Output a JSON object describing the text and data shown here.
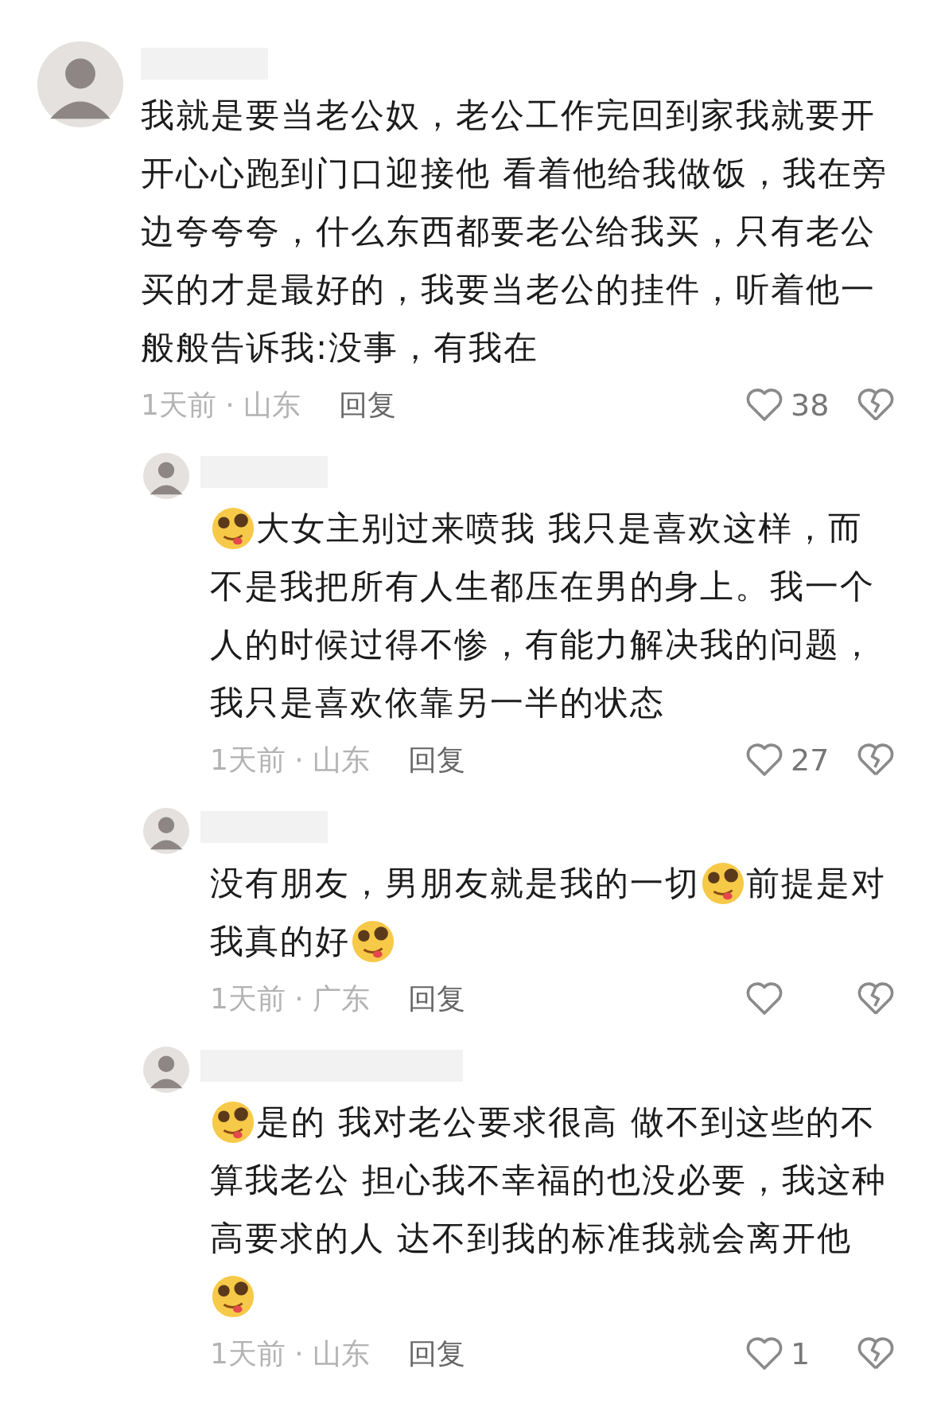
{
  "comments": [
    {
      "lines": [
        [
          {
            "kind": "text",
            "text": "我就是要当老公奴，老公工作完回到家我就要开"
          }
        ],
        [
          {
            "kind": "text",
            "text": "开心心跑到门口迎接他 看着他给我做饭，我在旁"
          }
        ],
        [
          {
            "kind": "text",
            "text": "边夸夸夸，什么东西都要老公给我买，只有老公"
          }
        ],
        [
          {
            "kind": "text",
            "text": "买的才是最好的，我要当老公的挂件，听着他一"
          }
        ],
        [
          {
            "kind": "text",
            "text": "般般告诉我:没事，有我在"
          }
        ]
      ],
      "meta": "1天前 · 山东",
      "reply": "回复",
      "likes": "38",
      "children": [
        {
          "lines": [
            [
              {
                "kind": "emoji"
              },
              {
                "kind": "text",
                "text": "大女主别过来喷我 我只是喜欢这样，而"
              }
            ],
            [
              {
                "kind": "text",
                "text": "不是我把所有人生都压在男的身上。我一个"
              }
            ],
            [
              {
                "kind": "text",
                "text": "人的时候过得不惨，有能力解决我的问题，"
              }
            ],
            [
              {
                "kind": "text",
                "text": "我只是喜欢依靠另一半的状态"
              }
            ]
          ],
          "meta": "1天前 · 山东",
          "reply": "回复",
          "likes": "27"
        },
        {
          "lines": [
            [
              {
                "kind": "text",
                "text": "没有朋友，男朋友就是我的一切"
              },
              {
                "kind": "emoji"
              },
              {
                "kind": "text",
                "text": "前提是对"
              }
            ],
            [
              {
                "kind": "text",
                "text": "我真的好"
              },
              {
                "kind": "emoji"
              }
            ]
          ],
          "meta": "1天前 · 广东",
          "reply": "回复"
        },
        {
          "lines": [
            [
              {
                "kind": "emoji"
              },
              {
                "kind": "text",
                "text": "是的 我对老公要求很高 做不到这些的不"
              }
            ],
            [
              {
                "kind": "text",
                "text": "算我老公 担心我不幸福的也没必要，我这种"
              }
            ],
            [
              {
                "kind": "text",
                "text": "高要求的人 达不到我的标准我就会离开他"
              }
            ],
            [
              {
                "kind": "emoji"
              }
            ]
          ],
          "meta": "1天前 · 山东",
          "reply": "回复",
          "likes": "1"
        }
      ]
    }
  ]
}
